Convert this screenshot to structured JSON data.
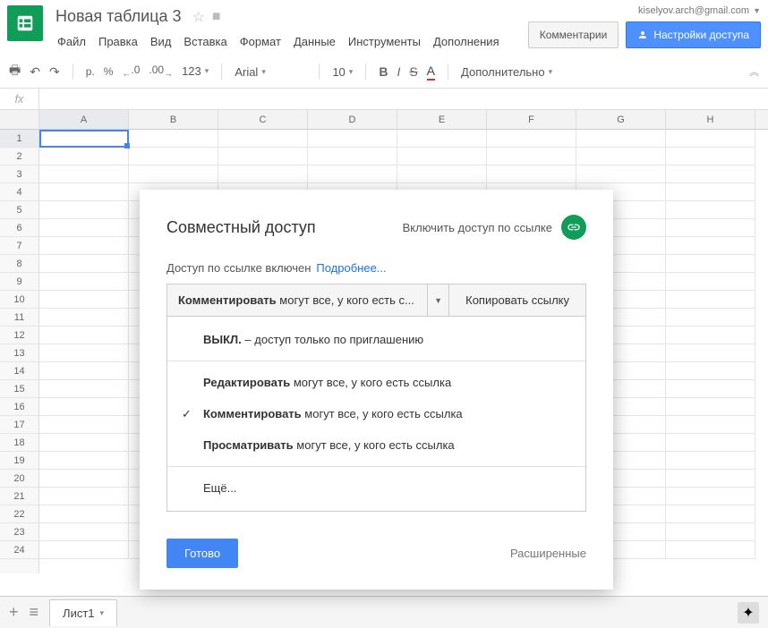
{
  "doc": {
    "title": "Новая таблица 3"
  },
  "user": {
    "email": "kiselyov.arch@gmail.com"
  },
  "menus": [
    "Файл",
    "Правка",
    "Вид",
    "Вставка",
    "Формат",
    "Данные",
    "Инструменты",
    "Дополнения"
  ],
  "header": {
    "comments": "Комментарии",
    "share": "Настройки доступа"
  },
  "toolbar": {
    "currency": "p.",
    "percent": "%",
    "dec0": ".0",
    "dec00": ".00",
    "numfmt": "123",
    "font": "Arial",
    "size": "10",
    "more": "Дополнительно"
  },
  "columns": [
    "A",
    "B",
    "C",
    "D",
    "E",
    "F",
    "G",
    "H"
  ],
  "rows": [
    "1",
    "2",
    "3",
    "4",
    "5",
    "6",
    "7",
    "8",
    "9",
    "10",
    "11",
    "12",
    "13",
    "14",
    "15",
    "16",
    "17",
    "18",
    "19",
    "20",
    "21",
    "22",
    "23",
    "24"
  ],
  "sheet": {
    "tab": "Лист1"
  },
  "modal": {
    "title": "Совместный доступ",
    "enable_link": "Включить доступ по ссылке",
    "sub": "Доступ по ссылке включен",
    "learn_more": "Подробнее...",
    "selected_bold": "Комментировать",
    "selected_rest": " могут все, у кого есть с...",
    "copy": "Копировать ссылку",
    "options": {
      "off_bold": "ВЫКЛ.",
      "off_rest": " – доступ только по приглашению",
      "edit_bold": "Редактировать",
      "edit_rest": " могут все, у кого есть ссылка",
      "comment_bold": "Комментировать",
      "comment_rest": " могут все, у кого есть ссылка",
      "view_bold": "Просматривать",
      "view_rest": " могут все, у кого есть ссылка",
      "more": "Ещё..."
    },
    "done": "Готово",
    "advanced": "Расширенные"
  }
}
